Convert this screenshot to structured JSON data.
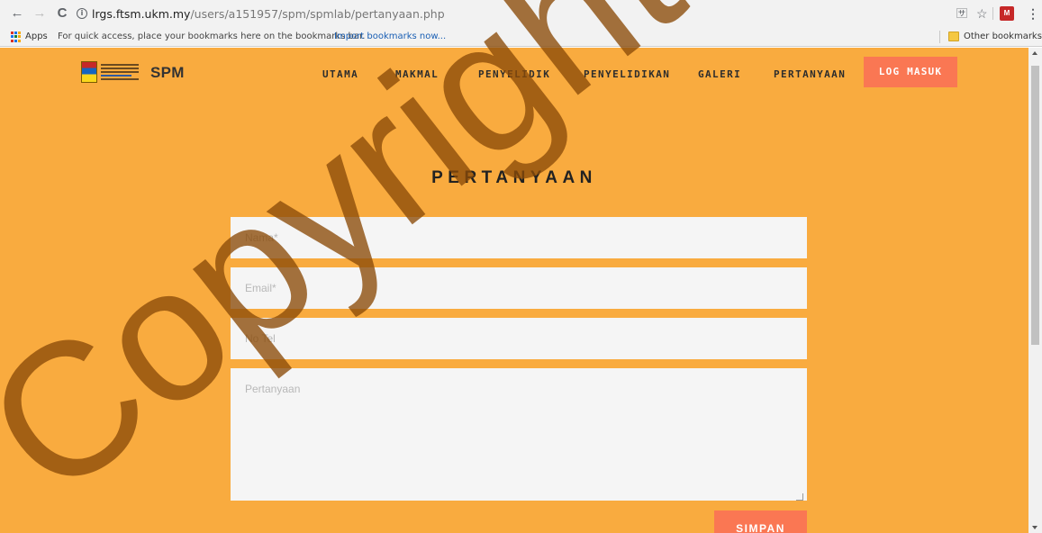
{
  "browser": {
    "back_glyph": "←",
    "forward_glyph": "→",
    "reload_glyph": "C",
    "url_host": "lrgs.ftsm.ukm.my",
    "url_path": "/users/a151957/spm/spmlab/pertanyaan.php",
    "info_glyph": "i",
    "translate_glyph": "🈂",
    "star_glyph": "☆",
    "ext_label": "M",
    "menu_glyph": "⋮"
  },
  "bookmarks": {
    "apps": "Apps",
    "hint": "For quick access, place your bookmarks here on the bookmarks bar.",
    "import": "Import bookmarks now...",
    "other": "Other bookmarks"
  },
  "site": {
    "brand": "SPM",
    "nav": [
      {
        "label": "UTAMA"
      },
      {
        "label": "MAKMAL"
      },
      {
        "label": "PENYELIDIK"
      },
      {
        "label": "PENYELIDIKAN"
      },
      {
        "label": "GALERI"
      },
      {
        "label": "PERTANYAAN"
      }
    ],
    "login": "LOG MASUK"
  },
  "form": {
    "heading": "PERTANYAAN",
    "name_placeholder": "Nama*",
    "email_placeholder": "Email*",
    "phone_placeholder": "No Tel",
    "question_placeholder": "Pertanyaan",
    "submit": "SIMPAN"
  },
  "watermark": {
    "text": "Copyright©"
  },
  "colors": {
    "page_bg": "#f9ab3f",
    "accent": "#fa7753",
    "field_bg": "#f5f5f5",
    "watermark": "#8a4a08"
  }
}
